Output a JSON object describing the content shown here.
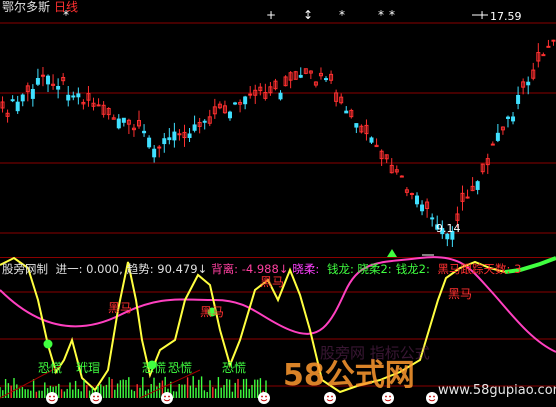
{
  "title": {
    "name": "鄂尔多斯",
    "period": "日线"
  },
  "price": {
    "high_label": "17.59",
    "low_label": "9.14"
  },
  "signals_top": [
    "*",
    "+",
    "↕",
    "*",
    "*",
    "*",
    "+"
  ],
  "indicator": {
    "name": "股旁网制",
    "fields": [
      {
        "label": "进一:",
        "value": "0.000,",
        "color": "#e0e0e0"
      },
      {
        "label": "趋势:",
        "value": "90.479↓",
        "color": "#e0e0e0"
      },
      {
        "label": "背离:",
        "value": "-4.988↓",
        "color": "#ff40a0"
      },
      {
        "label": "晓柔:",
        "value": "",
        "color": "#ff40ff"
      },
      {
        "label": "钱龙:",
        "value": "晓柔2:",
        "color": "#40ff40"
      },
      {
        "label": "钱龙2:",
        "value": "",
        "color": "#40ff40"
      },
      {
        "label": "黑马跟踪天数:",
        "value": "3",
        "color": "#ff3030"
      }
    ],
    "labels": {
      "kongjin": "恐慌",
      "heima": "黑马",
      "daimao": "玳瑁"
    }
  },
  "watermark": {
    "brand": "58公式网",
    "url": "www.58gupiao.com",
    "bg_text": "股旁网 指标公式"
  },
  "colors": {
    "up": "#ff3030",
    "down": "#40e0ff",
    "yellow": "#ffff40",
    "magenta": "#ff40c0",
    "green": "#40ff40",
    "grid": "#8a0000"
  }
}
